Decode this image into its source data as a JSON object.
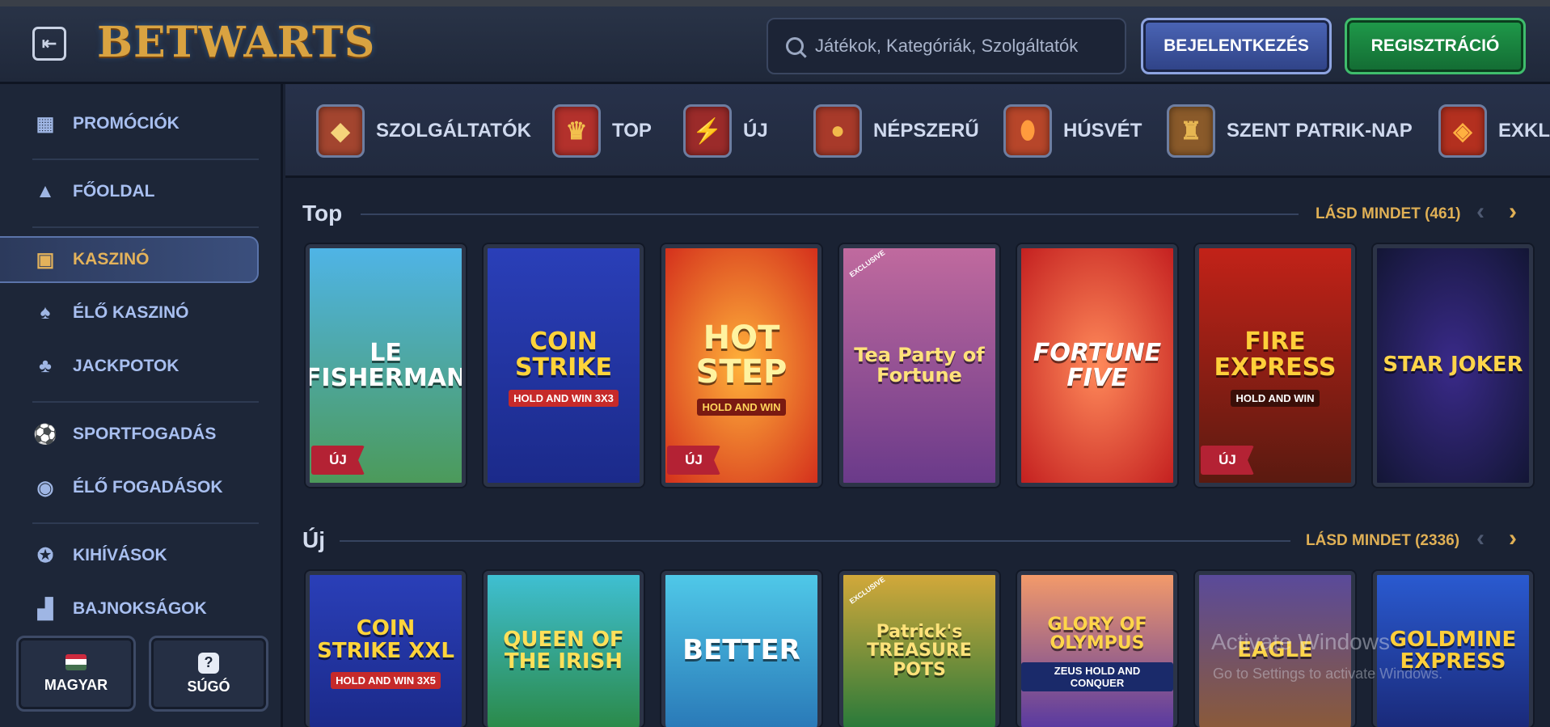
{
  "header": {
    "logo": "BETWARTS",
    "search_placeholder": "Játékok, Kategóriák, Szolgáltatók",
    "login_label": "BEJELENTKEZÉS",
    "register_label": "REGISZTRÁCIÓ"
  },
  "sidebar": {
    "items": [
      {
        "label": "PROMÓCIÓK",
        "icon": "gift-icon"
      },
      {
        "label": "FŐOLDAL",
        "icon": "wizard-hat-icon"
      },
      {
        "label": "KASZINÓ",
        "icon": "treasure-chest-icon"
      },
      {
        "label": "ÉLŐ KASZINÓ",
        "icon": "cards-icon"
      },
      {
        "label": "JACKPOTOK",
        "icon": "clover-icon"
      },
      {
        "label": "SPORTFOGADÁS",
        "icon": "soccer-ball-icon"
      },
      {
        "label": "ÉLŐ FOGADÁSOK",
        "icon": "live-icon"
      },
      {
        "label": "KIHÍVÁSOK",
        "icon": "medal-icon"
      },
      {
        "label": "BAJNOKSÁGOK",
        "icon": "podium-icon"
      }
    ],
    "language_label": "MAGYAR",
    "help_label": "SÚGÓ"
  },
  "categories": [
    {
      "label": "SZOLGÁLTATÓK",
      "icon": "book-icon"
    },
    {
      "label": "TOP",
      "icon": "crown-icon"
    },
    {
      "label": "ÚJ",
      "icon": "lightning-icon"
    },
    {
      "label": "NÉPSZERŰ",
      "icon": "potion-icon"
    },
    {
      "label": "HÚSVÉT",
      "icon": "egg-icon"
    },
    {
      "label": "SZENT PATRIK-NAP",
      "icon": "hat-icon"
    },
    {
      "label": "EXKLU",
      "icon": "gem-icon"
    }
  ],
  "sections": [
    {
      "title": "Top",
      "see_all": "LÁSD MINDET (461)",
      "games": [
        {
          "title": "LE FISHERMAN",
          "badge": "ÚJ",
          "exclusive": ""
        },
        {
          "title": "COIN STRIKE",
          "subtitle": "HOLD AND WIN 3X3",
          "badge": "",
          "exclusive": ""
        },
        {
          "title": "HOT STEP",
          "subtitle": "HOLD AND WIN",
          "badge": "ÚJ",
          "exclusive": ""
        },
        {
          "title": "Tea Party of Fortune",
          "badge": "",
          "exclusive": "EXCLUSIVE"
        },
        {
          "title": "FORTUNE FIVE",
          "badge": "",
          "exclusive": ""
        },
        {
          "title": "FIRE EXPRESS",
          "subtitle": "HOLD AND WIN",
          "badge": "ÚJ",
          "exclusive": ""
        },
        {
          "title": "STAR JOKER",
          "badge": "",
          "exclusive": ""
        }
      ]
    },
    {
      "title": "Új",
      "see_all": "LÁSD MINDET (2336)",
      "games": [
        {
          "title": "COIN STRIKE XXL",
          "subtitle": "HOLD AND WIN 3X5",
          "exclusive": ""
        },
        {
          "title": "QUEEN OF THE IRISH",
          "exclusive": ""
        },
        {
          "title": "BETTER",
          "exclusive": ""
        },
        {
          "title": "Patrick's TREASURE POTS",
          "exclusive": "EXCLUSIVE"
        },
        {
          "title": "GLORY OF OLYMPUS",
          "subtitle": "ZEUS HOLD AND CONQUER",
          "exclusive": ""
        },
        {
          "title": "EAGLE",
          "exclusive": ""
        },
        {
          "title": "GOLDMINE EXPRESS",
          "exclusive": ""
        }
      ]
    }
  ],
  "watermark": {
    "line1": "Activate Windows",
    "line2": "Go to Settings to activate Windows."
  },
  "colors": {
    "accent_gold": "#e0b055",
    "login_blue": "#3c53a0",
    "register_green": "#1a8a40",
    "badge_red": "#b42234"
  }
}
